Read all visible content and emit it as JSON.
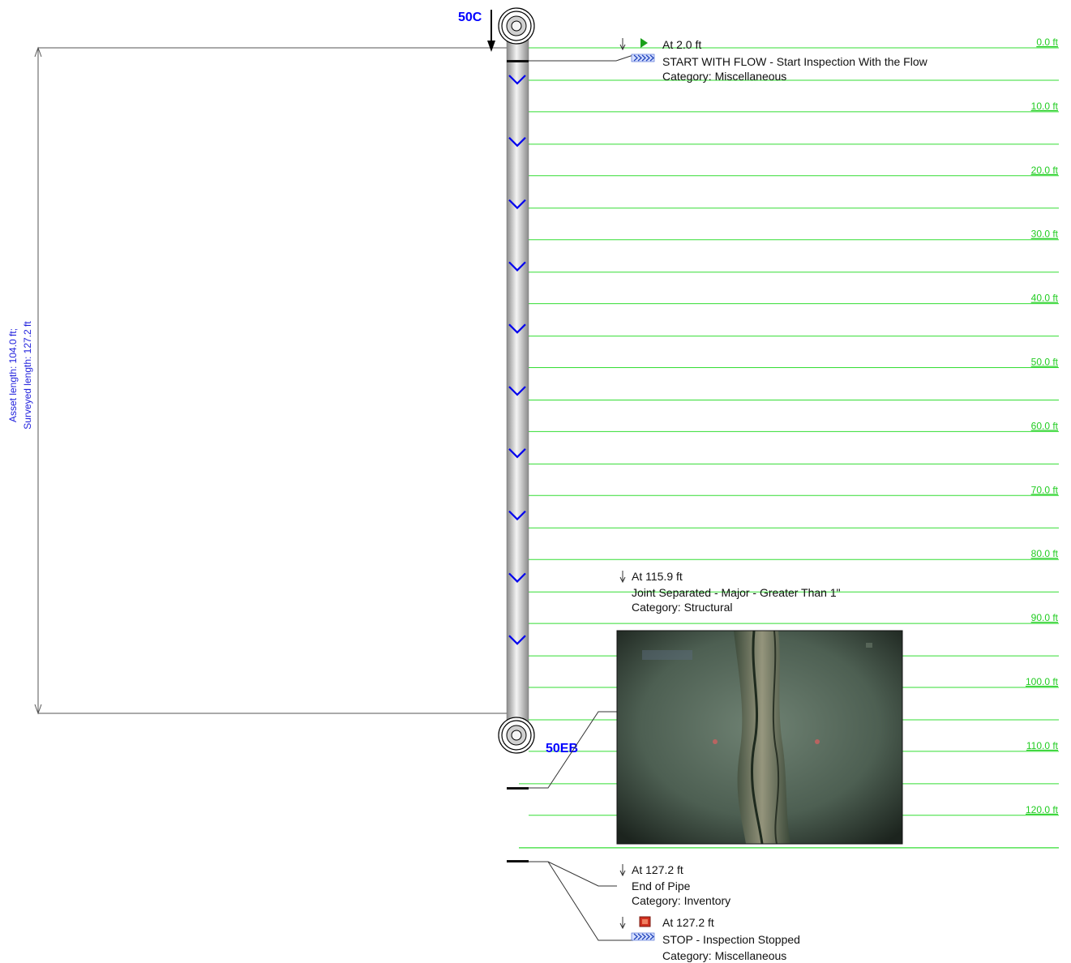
{
  "nodes": {
    "upstream": "50C",
    "downstream": "50EB"
  },
  "dimension": {
    "asset_length": "Asset length: 104.0 ft;",
    "surveyed_length": "Surveyed length: 127.2 ft"
  },
  "scale_labels": [
    "0.0 ft",
    "10.0 ft",
    "20.0 ft",
    "30.0 ft",
    "40.0 ft",
    "50.0 ft",
    "60.0 ft",
    "70.0 ft",
    "80.0 ft",
    "90.0 ft",
    "100.0 ft",
    "110.0 ft",
    "120.0 ft"
  ],
  "observations": [
    {
      "position": "At 2.0 ft",
      "description": "START WITH FLOW - Start Inspection With the Flow",
      "category": "Category: Miscellaneous",
      "icon": "start-flag-icon"
    },
    {
      "position": "At 115.9 ft",
      "description": "Joint Separated - Major - Greater Than 1\"",
      "category": "Category: Structural",
      "icon": "",
      "has_photo": true
    },
    {
      "position": "At 127.2 ft",
      "description": "End of Pipe",
      "category": "Category: Inventory",
      "icon": ""
    },
    {
      "position": "At 127.2 ft",
      "description": "STOP - Inspection Stopped",
      "category": "Category: Miscellaneous",
      "icon": "stop-square-icon"
    }
  ],
  "colors": {
    "gridline": "#33dd33",
    "label_green": "#22cc22",
    "node_label": "#0000ff",
    "flow_chevron": "#0000ee",
    "dimension_text": "#2222dd"
  }
}
